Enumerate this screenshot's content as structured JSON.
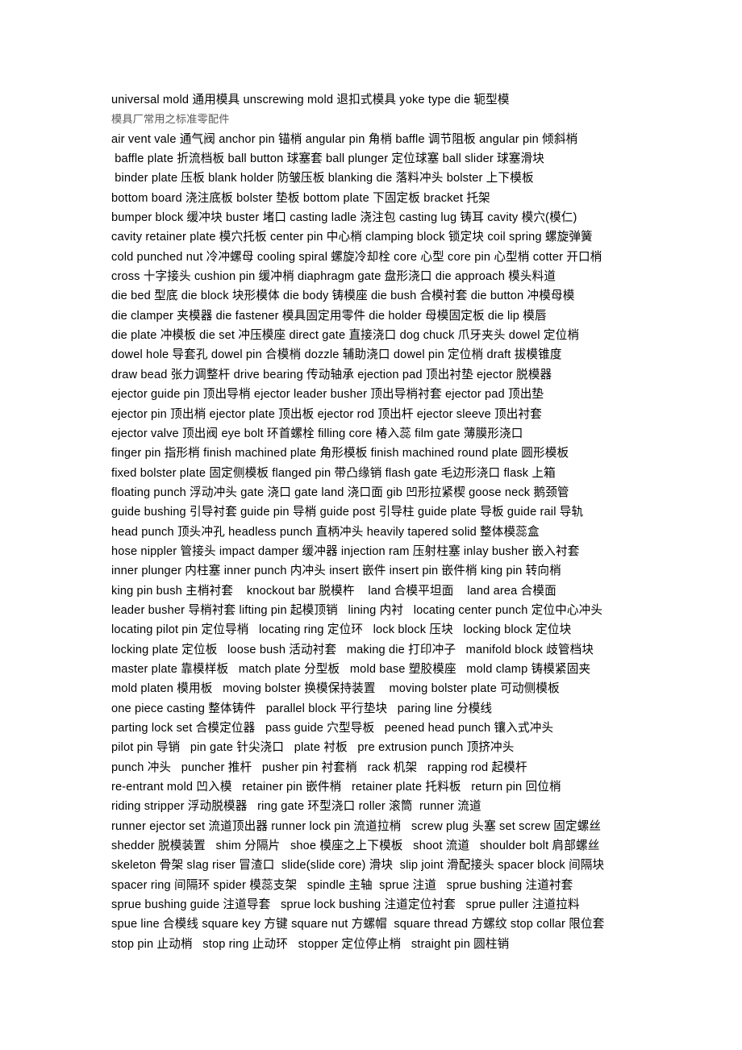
{
  "document": {
    "page_background": "#ffffff",
    "text_color": "#000000",
    "subheading_color": "#595959",
    "lines": [
      {
        "text": "universal mold 通用模具 unscrewing mold 退扣式模具 yoke type die 轭型模",
        "style": "normal"
      },
      {
        "text": "模具厂常用之标准零配件",
        "style": "sub-heading"
      },
      {
        "text": "air vent vale 通气阀 anchor pin 锚梢 angular pin 角梢 baffle 调节阻板 angular pin 倾斜梢",
        "style": "normal"
      },
      {
        "text": " baffle plate 折流档板 ball button 球塞套 ball plunger 定位球塞 ball slider 球塞滑块",
        "style": "normal"
      },
      {
        "text": " binder plate 压板 blank holder 防皱压板 blanking die 落料冲头 bolster 上下模板",
        "style": "normal"
      },
      {
        "text": "bottom board 浇注底板 bolster 垫板 bottom plate 下固定板 bracket 托架",
        "style": "normal"
      },
      {
        "text": "bumper block 缓冲块 buster 堵口 casting ladle 浇注包 casting lug 铸耳 cavity 模穴(模仁)",
        "style": "normal"
      },
      {
        "text": "cavity retainer plate 模穴托板 center pin 中心梢 clamping block 锁定块 coil spring 螺旋弹簧",
        "style": "normal"
      },
      {
        "text": "cold punched nut 冷冲螺母 cooling spiral 螺旋冷却栓 core 心型 core pin 心型梢 cotter 开口梢",
        "style": "normal"
      },
      {
        "text": "cross 十字接头 cushion pin 缓冲梢 diaphragm gate 盘形浇口 die approach 模头料道",
        "style": "normal"
      },
      {
        "text": "die bed 型底 die block 块形模体 die body 铸模座 die bush 合模衬套 die button 冲模母模",
        "style": "normal"
      },
      {
        "text": "die clamper 夹模器 die fastener 模具固定用零件 die holder 母模固定板 die lip 模唇",
        "style": "normal"
      },
      {
        "text": "die plate 冲模板 die set 冲压模座 direct gate 直接浇口 dog chuck 爪牙夹头 dowel 定位梢",
        "style": "normal"
      },
      {
        "text": "dowel hole 导套孔 dowel pin 合模梢 dozzle 辅助浇口 dowel pin 定位梢 draft 拔模锥度",
        "style": "normal"
      },
      {
        "text": "draw bead 张力调整杆 drive bearing 传动轴承 ejection pad 顶出衬垫 ejector 脱模器",
        "style": "normal"
      },
      {
        "text": "ejector guide pin 顶出导梢 ejector leader busher 顶出导梢衬套 ejector pad 顶出垫",
        "style": "normal"
      },
      {
        "text": "ejector pin 顶出梢 ejector plate 顶出板 ejector rod 顶出杆 ejector sleeve 顶出衬套",
        "style": "normal"
      },
      {
        "text": "ejector valve 顶出阀 eye bolt 环首螺栓 filling core 椿入蕊 film gate 薄膜形浇口",
        "style": "normal"
      },
      {
        "text": "finger pin 指形梢 finish machined plate 角形模板 finish machined round plate 圆形模板",
        "style": "normal"
      },
      {
        "text": "fixed bolster plate 固定侧模板 flanged pin 带凸缘销 flash gate 毛边形浇口 flask 上箱",
        "style": "normal"
      },
      {
        "text": "floating punch 浮动冲头 gate 浇口 gate land 浇口面 gib 凹形拉紧楔 goose neck 鹅颈管",
        "style": "normal"
      },
      {
        "text": "guide bushing 引导衬套 guide pin 导梢 guide post 引导柱 guide plate 导板 guide rail 导轨",
        "style": "normal"
      },
      {
        "text": "head punch 顶头冲孔 headless punch 直柄冲头 heavily tapered solid 整体模蕊盒",
        "style": "normal"
      },
      {
        "text": "hose nippler 管接头 impact damper 缓冲器 injection ram 压射柱塞 inlay busher 嵌入衬套",
        "style": "normal"
      },
      {
        "text": "inner plunger 内柱塞 inner punch 内冲头 insert 嵌件 insert pin 嵌件梢 king pin 转向梢",
        "style": "normal"
      },
      {
        "text": "king pin bush 主梢衬套    knockout bar 脱模杵    land 合模平坦面    land area 合模面",
        "style": "normal"
      },
      {
        "text": "leader busher 导梢衬套 lifting pin 起模顶销   lining 内衬   locating center punch 定位中心冲头",
        "style": "normal"
      },
      {
        "text": "locating pilot pin 定位导梢   locating ring 定位环   lock block 压块   locking block 定位块",
        "style": "normal"
      },
      {
        "text": "locking plate 定位板   loose bush 活动衬套   making die 打印冲子   manifold block 歧管档块",
        "style": "normal"
      },
      {
        "text": "master plate 靠模样板   match plate 分型板   mold base 塑胶模座   mold clamp 铸模紧固夹",
        "style": "normal"
      },
      {
        "text": "mold platen 模用板   moving bolster 换模保持装置    moving bolster plate 可动侧模板",
        "style": "normal"
      },
      {
        "text": "one piece casting 整体铸件   parallel block 平行垫块   paring line 分模线",
        "style": "normal"
      },
      {
        "text": "parting lock set 合模定位器   pass guide 穴型导板   peened head punch 镶入式冲头",
        "style": "normal"
      },
      {
        "text": "pilot pin 导销   pin gate 针尖浇口   plate 衬板   pre extrusion punch 顶挤冲头",
        "style": "normal"
      },
      {
        "text": "punch 冲头   puncher 推杆   pusher pin 衬套梢   rack 机架   rapping rod 起模杆",
        "style": "normal"
      },
      {
        "text": "re-entrant mold 凹入模   retainer pin 嵌件梢   retainer plate 托料板   return pin 回位梢",
        "style": "normal"
      },
      {
        "text": "riding stripper 浮动脱模器   ring gate 环型浇口 roller 滚筒  runner 流道",
        "style": "normal"
      },
      {
        "text": "runner ejector set 流道顶出器 runner lock pin 流道拉梢   screw plug 头塞 set screw 固定螺丝",
        "style": "normal"
      },
      {
        "text": "shedder 脱模装置   shim 分隔片   shoe 模座之上下模板   shoot 流道   shoulder bolt 肩部螺丝",
        "style": "normal"
      },
      {
        "text": "skeleton 骨架 slag riser 冒渣口  slide(slide core) 滑块  slip joint 滑配接头 spacer block 间隔块",
        "style": "normal"
      },
      {
        "text": "spacer ring 间隔环 spider 模蕊支架   spindle 主轴  sprue 注道   sprue bushing 注道衬套",
        "style": "normal"
      },
      {
        "text": "sprue bushing guide 注道导套   sprue lock bushing 注道定位衬套   sprue puller 注道拉料",
        "style": "normal"
      },
      {
        "text": "spue line 合模线 square key 方键 square nut 方螺帽  square thread 方螺纹 stop collar 限位套",
        "style": "normal"
      },
      {
        "text": "stop pin 止动梢   stop ring 止动环   stopper 定位停止梢   straight pin 圆柱销",
        "style": "normal"
      }
    ]
  }
}
